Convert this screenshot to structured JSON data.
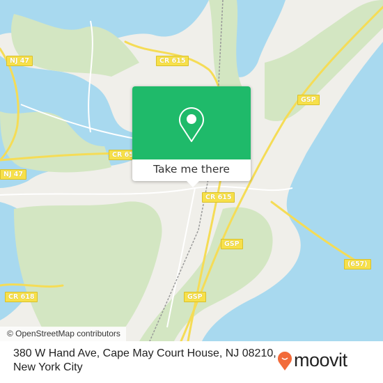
{
  "map": {
    "colors": {
      "land": "#f0efea",
      "forest": "#d3e6c2",
      "water": "#a8d9ef",
      "road": "#f5dc56",
      "minor_road": "#ffffff"
    },
    "road_labels": [
      {
        "id": "nj47-north",
        "text": "NJ 47"
      },
      {
        "id": "nj47-west",
        "text": "NJ 47"
      },
      {
        "id": "cr615-north",
        "text": "CR 615"
      },
      {
        "id": "cr65-west",
        "text": "CR 65"
      },
      {
        "id": "cr615-center",
        "text": "CR 615"
      },
      {
        "id": "gsp-north",
        "text": "GSP"
      },
      {
        "id": "gsp-center",
        "text": "GSP"
      },
      {
        "id": "gsp-south",
        "text": "GSP"
      },
      {
        "id": "r657",
        "text": "(657)"
      },
      {
        "id": "cr618",
        "text": "CR 618"
      }
    ],
    "attribution": "© OpenStreetMap contributors"
  },
  "popup": {
    "icon": "map-pin-icon",
    "button_label": "Take me there",
    "accent": "#1fba6a"
  },
  "footer": {
    "address_line1": "380 W Hand Ave, Cape May Court House, NJ 08210,",
    "address_line2": "New York City",
    "brand": "moovit",
    "brand_color": "#f26b3a"
  }
}
